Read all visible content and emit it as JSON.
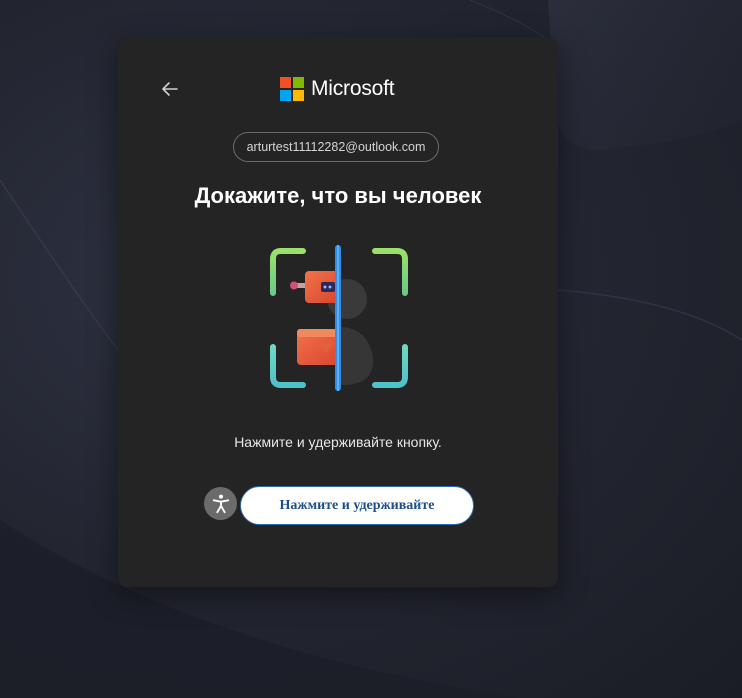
{
  "brand": {
    "name": "Microsoft",
    "logo_colors": [
      "#f25022",
      "#7fba00",
      "#00a4ef",
      "#ffb900"
    ]
  },
  "header": {
    "back_icon": "arrow-left-icon"
  },
  "account": {
    "email": "arturtest11112282@outlook.com"
  },
  "challenge": {
    "title": "Докажите, что вы человек",
    "instruction": "Нажмите и удерживайте кнопку.",
    "button_label": "Нажмите и удерживайте",
    "accessibility_icon": "accessibility-person-icon",
    "illustration_icon": "robot-human-scan-icon"
  },
  "colors": {
    "card_bg": "#242424",
    "page_bg": "#22242f",
    "button_border": "#2b6cb0",
    "button_text": "#1d4f8c"
  }
}
